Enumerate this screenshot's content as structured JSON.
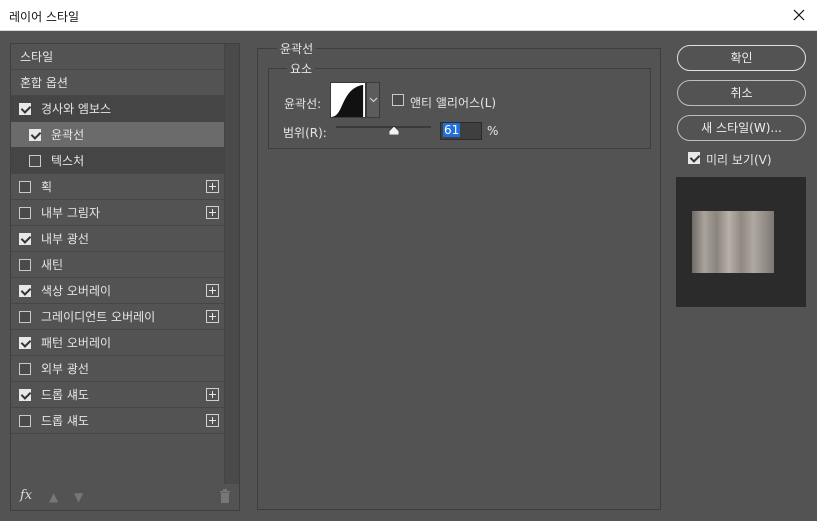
{
  "window": {
    "title": "레이어 스타일"
  },
  "left": {
    "header_items": [
      {
        "label": "스타일"
      },
      {
        "label": "혼합 옵션"
      }
    ],
    "effects": [
      {
        "label": "경사와 엠보스",
        "checked": true,
        "has_add": false,
        "indent": false,
        "state": "dark"
      },
      {
        "label": "윤곽선",
        "checked": true,
        "has_add": false,
        "indent": true,
        "state": "selected"
      },
      {
        "label": "텍스처",
        "checked": false,
        "has_add": false,
        "indent": true,
        "state": "dark"
      },
      {
        "label": "획",
        "checked": false,
        "has_add": true,
        "indent": false,
        "state": ""
      },
      {
        "label": "내부 그림자",
        "checked": false,
        "has_add": true,
        "indent": false,
        "state": ""
      },
      {
        "label": "내부 광선",
        "checked": true,
        "has_add": false,
        "indent": false,
        "state": ""
      },
      {
        "label": "새틴",
        "checked": false,
        "has_add": false,
        "indent": false,
        "state": ""
      },
      {
        "label": "색상 오버레이",
        "checked": true,
        "has_add": true,
        "indent": false,
        "state": ""
      },
      {
        "label": "그레이디언트 오버레이",
        "checked": false,
        "has_add": true,
        "indent": false,
        "state": ""
      },
      {
        "label": "패턴 오버레이",
        "checked": true,
        "has_add": false,
        "indent": false,
        "state": ""
      },
      {
        "label": "외부 광선",
        "checked": false,
        "has_add": false,
        "indent": false,
        "state": ""
      },
      {
        "label": "드롭 섀도",
        "checked": true,
        "has_add": true,
        "indent": false,
        "state": ""
      },
      {
        "label": "드롭 섀도",
        "checked": false,
        "has_add": true,
        "indent": false,
        "state": ""
      }
    ],
    "footer": {
      "fx_label": "fx"
    }
  },
  "contour_panel": {
    "title": "윤곽선",
    "section": "요소",
    "contour_label": "윤곽선:",
    "anti_alias_label": "앤티 앨리어스(L)",
    "anti_alias_checked": false,
    "range_label": "범위(R):",
    "range_value": "61",
    "range_fraction": 0.61,
    "range_unit": "%"
  },
  "right": {
    "ok_label": "확인",
    "cancel_label": "취소",
    "new_style_label": "새 스타일(W)...",
    "preview_label": "미리 보기(V)",
    "preview_checked": true
  }
}
